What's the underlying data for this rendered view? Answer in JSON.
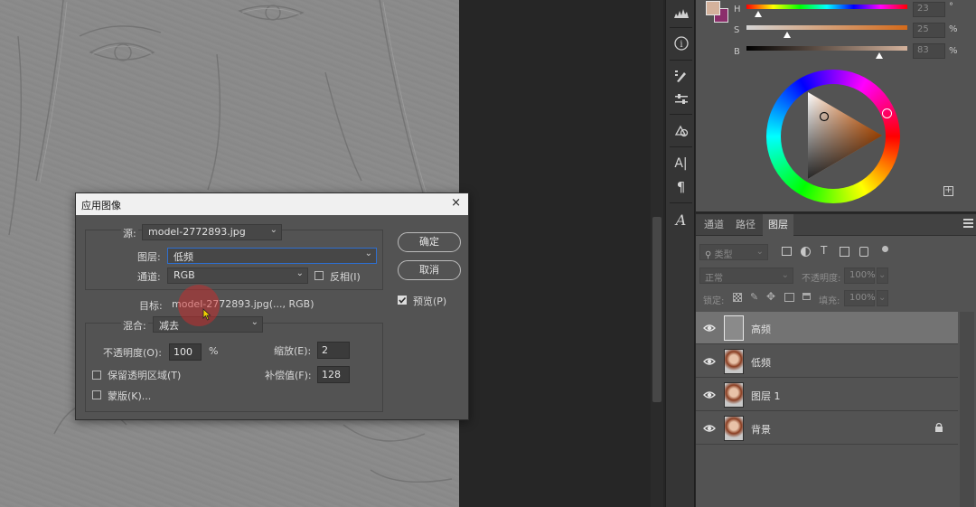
{
  "dialog": {
    "title": "应用图像",
    "close_glyph": "×",
    "source_label": "源:",
    "source_value": "model-2772893.jpg",
    "layer_label": "图层:",
    "layer_value": "低频",
    "channel_label": "通道:",
    "channel_value": "RGB",
    "invert_label": "反相(I)",
    "target_label": "目标:",
    "target_value": "model-2772893.jpg(..., RGB)",
    "blending_label": "混合:",
    "blending_value": "减去",
    "opacity_label": "不透明度(O):",
    "opacity_value": "100",
    "opacity_unit": "%",
    "scale_label": "缩放(E):",
    "scale_value": "2",
    "preserve_transparency_label": "保留透明区域(T)",
    "offset_label": "补偿值(F):",
    "offset_value": "128",
    "mask_label": "蒙版(K)...",
    "ok_label": "确定",
    "cancel_label": "取消",
    "preview_label": "预览(P)",
    "preview_checked": true,
    "invert_checked": false,
    "preserve_transparency_checked": false,
    "mask_checked": false
  },
  "color_panel": {
    "h_label": "H",
    "s_label": "S",
    "b_label": "B",
    "h_value": "23",
    "s_value": "25",
    "b_value": "83",
    "h_unit": "°",
    "s_unit": "%",
    "b_unit": "%",
    "foreground_color": "#d4b29c",
    "background_color": "#8b2e6b"
  },
  "layers_panel": {
    "tabs": [
      {
        "label": "通道"
      },
      {
        "label": "路径"
      },
      {
        "label": "图层"
      }
    ],
    "filter_placeholder": "类型",
    "blend_mode": "正常",
    "opacity_label": "不透明度:",
    "opacity_value": "100%",
    "lock_label": "锁定:",
    "fill_label": "填充:",
    "fill_value": "100%",
    "layers": [
      {
        "name": "高频"
      },
      {
        "name": "低频"
      },
      {
        "name": "图层 1"
      },
      {
        "name": "背景"
      }
    ]
  },
  "tools": {
    "paragraph_glyph": "¶",
    "character_glyph": "A|",
    "glyphs_glyph": "A",
    "info_glyph": "i"
  },
  "colors": {
    "accent_focus": "#2e6fd0",
    "panel_bg": "#535353",
    "selected_layer": "#737373"
  }
}
